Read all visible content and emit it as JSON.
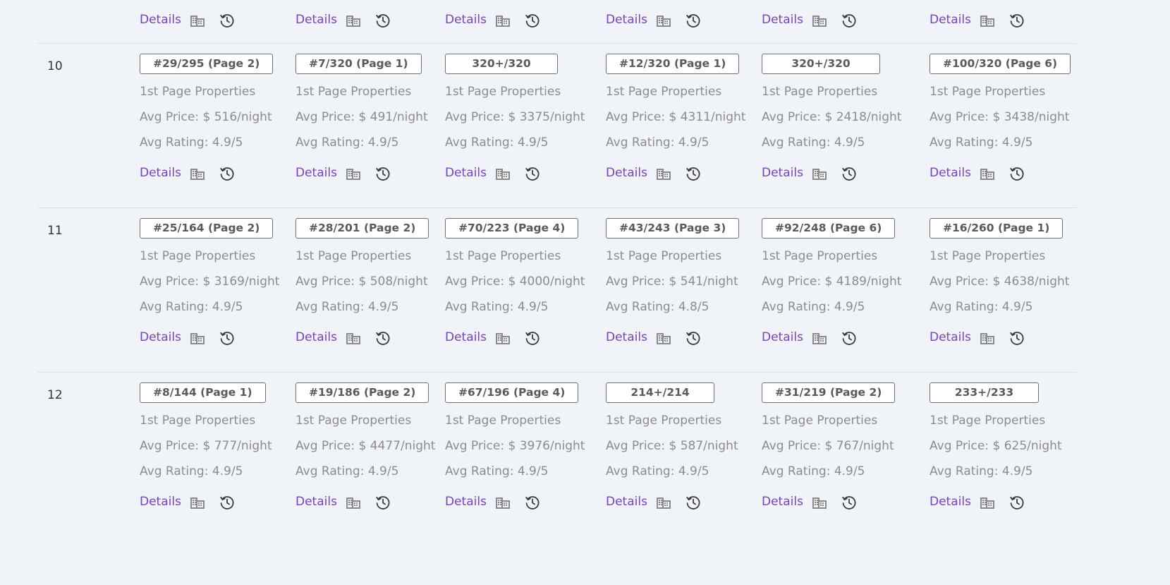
{
  "labels": {
    "details": "Details",
    "first_page": "1st Page Properties",
    "price_prefix": "Avg Price: $ ",
    "price_suffix": "/night",
    "rating_prefix": "Avg Rating: ",
    "rating_suffix": "/5"
  },
  "icons": {
    "building": "building-icon",
    "history": "history-clock-icon"
  },
  "colors": {
    "background": "#f0f4f9",
    "link": "#7b3fc4",
    "muted_text": "#8c8c8c",
    "box_text": "#5a5a5a",
    "icon_gray": "#8a8a8a",
    "icon_dark": "#3b3b3b"
  },
  "partial_row_actions": 6,
  "rows": [
    {
      "num": "10",
      "cells": [
        {
          "rank": "#29/295 (Page 2)",
          "price": "516",
          "rating": "4.9"
        },
        {
          "rank": "#7/320 (Page 1)",
          "price": "491",
          "rating": "4.9"
        },
        {
          "rank": "320+/320",
          "price": "3375",
          "rating": "4.9"
        },
        {
          "rank": "#12/320 (Page 1)",
          "price": "4311",
          "rating": "4.9"
        },
        {
          "rank": "320+/320",
          "price": "2418",
          "rating": "4.9"
        },
        {
          "rank": "#100/320 (Page 6)",
          "price": "3438",
          "rating": "4.9"
        }
      ]
    },
    {
      "num": "11",
      "cells": [
        {
          "rank": "#25/164 (Page 2)",
          "price": "3169",
          "rating": "4.9"
        },
        {
          "rank": "#28/201 (Page 2)",
          "price": "508",
          "rating": "4.9"
        },
        {
          "rank": "#70/223 (Page 4)",
          "price": "4000",
          "rating": "4.9"
        },
        {
          "rank": "#43/243 (Page 3)",
          "price": "541",
          "rating": "4.8"
        },
        {
          "rank": "#92/248 (Page 6)",
          "price": "4189",
          "rating": "4.9"
        },
        {
          "rank": "#16/260 (Page 1)",
          "price": "4638",
          "rating": "4.9"
        }
      ]
    },
    {
      "num": "12",
      "cells": [
        {
          "rank": "#8/144 (Page 1)",
          "price": "777",
          "rating": "4.9"
        },
        {
          "rank": "#19/186 (Page 2)",
          "price": "4477",
          "rating": "4.9"
        },
        {
          "rank": "#67/196 (Page 4)",
          "price": "3976",
          "rating": "4.9"
        },
        {
          "rank": "214+/214",
          "price": "587",
          "rating": "4.9"
        },
        {
          "rank": "#31/219 (Page 2)",
          "price": "767",
          "rating": "4.9"
        },
        {
          "rank": "233+/233",
          "price": "625",
          "rating": "4.9"
        }
      ]
    }
  ]
}
